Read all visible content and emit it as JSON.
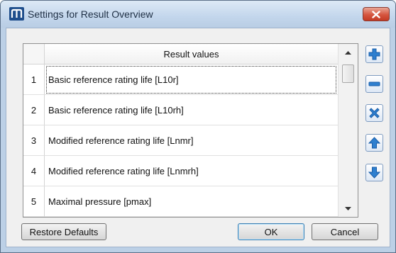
{
  "window": {
    "title": "Settings for Result Overview",
    "app_icon": "mesys-logo-icon",
    "close_icon": "close-icon"
  },
  "table": {
    "column_header": "Result values",
    "rows": [
      {
        "index": "1",
        "value": "Basic reference rating life [L10r]"
      },
      {
        "index": "2",
        "value": "Basic reference rating life [L10rh]"
      },
      {
        "index": "3",
        "value": "Modified reference rating life [Lnmr]"
      },
      {
        "index": "4",
        "value": "Modified reference rating life [Lnmrh]"
      },
      {
        "index": "5",
        "value": "Maximal pressure [pmax]"
      }
    ],
    "focused_row": 1
  },
  "side_toolbar": [
    {
      "name": "add-row-button",
      "icon": "plus-icon"
    },
    {
      "name": "remove-row-button",
      "icon": "minus-icon"
    },
    {
      "name": "clear-rows-button",
      "icon": "x-icon"
    },
    {
      "name": "move-up-button",
      "icon": "arrow-up-icon"
    },
    {
      "name": "move-down-button",
      "icon": "arrow-down-icon"
    }
  ],
  "buttons": {
    "restore_defaults": "Restore Defaults",
    "ok": "OK",
    "cancel": "Cancel"
  },
  "colors": {
    "accent_blue": "#2e7fcf",
    "close_red": "#d5553f",
    "frame": "#bcd0e6"
  }
}
